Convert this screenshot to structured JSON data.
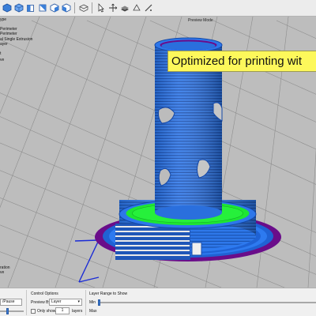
{
  "viewport": {
    "mode_label": "Preview Mode",
    "callout_text": "Optimized for printing wit"
  },
  "legend": {
    "top_lines": [
      "ype",
      "",
      "Perimeter",
      "Perimeter",
      "al Single Extrusion",
      "ayer",
      "",
      "t",
      "",
      "ve"
    ],
    "bottom_lines": [
      "ration",
      "ve"
    ]
  },
  "toolbar": {
    "icons": [
      "cube-icon",
      "cube-outline-icon",
      "cube-left-icon",
      "cube-right-icon",
      "cube-front-icon",
      "cube-back-icon",
      "grid-view-icon",
      "cursor-icon",
      "move-icon",
      "layers-icon",
      "rotate-icon",
      "ruler-icon"
    ]
  },
  "control_panel": {
    "play_label": "/Pause",
    "control_options_title": "Control Options",
    "preview_by_label": "Preview By",
    "preview_by_value": "Layer",
    "only_show_label": "Only show",
    "only_show_value": "1",
    "layers_label": "layers",
    "layer_range_title": "Layer Range to Show",
    "min_label": "Min",
    "max_label": "Max"
  },
  "colors": {
    "outer_wall": "#2a73e8",
    "infill_green": "#1ee632",
    "skirt_purple": "#6a0d8a",
    "callout_bg": "#fdf85b",
    "grid_bg": "#bdbdbd"
  }
}
